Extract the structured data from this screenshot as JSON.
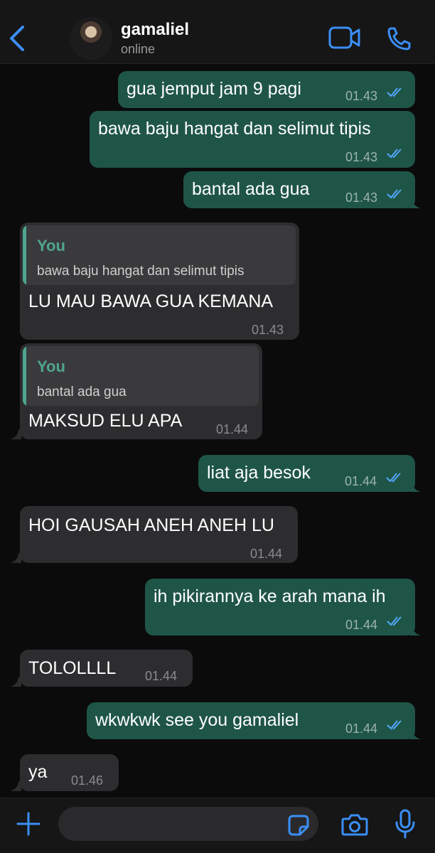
{
  "header": {
    "name": "gamaliel",
    "status": "online",
    "icons": {
      "back": "chevron-left-icon",
      "video": "video-camera-icon",
      "call": "phone-icon"
    }
  },
  "colors": {
    "outgoing_bubble": "#1f5547",
    "incoming_bubble": "#2d2d2f",
    "accent": "#3b8ff6",
    "read_ticks": "#53a6fa",
    "quote_name": "#4fa58f",
    "background": "#0b0b0b"
  },
  "messages": [
    {
      "direction": "outgoing",
      "text": "gua jemput jam 9 pagi",
      "time": "01.43",
      "status": "read"
    },
    {
      "direction": "outgoing",
      "text": "bawa baju hangat dan selimut tipis",
      "time": "01.43",
      "status": "read"
    },
    {
      "direction": "outgoing",
      "text": "bantal ada gua",
      "time": "01.43",
      "status": "read"
    },
    {
      "direction": "incoming",
      "text": "LU MAU BAWA GUA KEMANA",
      "time": "01.43",
      "reply_to": {
        "name": "You",
        "text": "bawa baju hangat dan selimut tipis"
      }
    },
    {
      "direction": "incoming",
      "text": "MAKSUD ELU APA",
      "time": "01.44",
      "reply_to": {
        "name": "You",
        "text": "bantal ada gua"
      }
    },
    {
      "direction": "outgoing",
      "text": "liat aja besok",
      "time": "01.44",
      "status": "read"
    },
    {
      "direction": "incoming",
      "text": "HOI GAUSAH ANEH ANEH LU",
      "time": "01.44"
    },
    {
      "direction": "outgoing",
      "text": "ih pikirannya ke arah mana ih",
      "time": "01.44",
      "status": "read"
    },
    {
      "direction": "incoming",
      "text": "TOLOLLLL",
      "time": "01.44"
    },
    {
      "direction": "outgoing",
      "text": "wkwkwk see you gamaliel",
      "time": "01.44",
      "status": "read"
    },
    {
      "direction": "incoming",
      "text": "ya",
      "time": "01.46"
    }
  ],
  "composer": {
    "placeholder": "",
    "value": "",
    "icons": {
      "attach": "plus-icon",
      "sticker": "sticker-icon",
      "camera": "camera-icon",
      "mic": "microphone-icon"
    }
  }
}
